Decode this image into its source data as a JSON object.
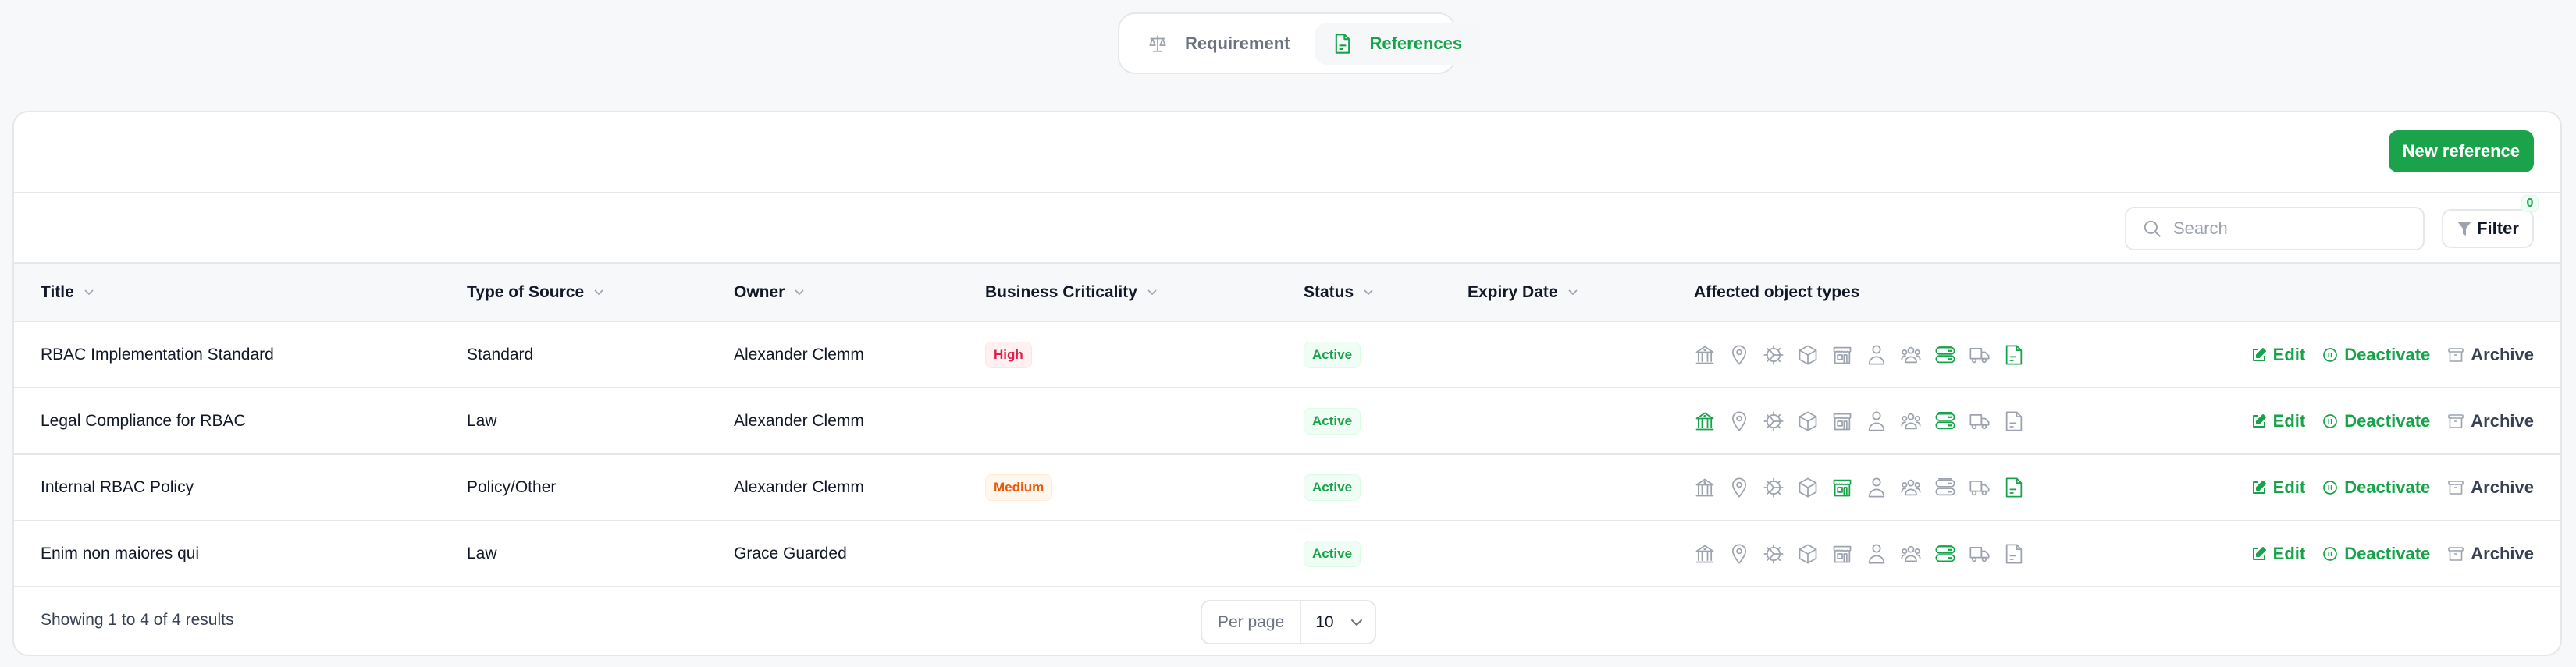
{
  "tabs": [
    {
      "label": "Requirement",
      "icon": "scale-icon",
      "active": false
    },
    {
      "label": "References",
      "icon": "document-icon",
      "active": true
    }
  ],
  "toolbar": {
    "new_button": "New reference",
    "search_placeholder": "Search",
    "search_value": "",
    "filter_label": "Filter",
    "filter_count": "0"
  },
  "colors": {
    "accent": "#16a34a",
    "icon_inactive": "#9ca3af",
    "high": "#e11d48",
    "medium": "#ea580c"
  },
  "table": {
    "columns": [
      "Title",
      "Type of Source",
      "Owner",
      "Business Criticality",
      "Status",
      "Expiry Date",
      "Affected object types"
    ],
    "object_types": [
      "bank-icon",
      "map-pin-icon",
      "gear-icon",
      "cube-icon",
      "store-icon",
      "user-icon",
      "users-icon",
      "server-icon",
      "truck-icon",
      "document-icon"
    ],
    "rows": [
      {
        "title": "RBAC Implementation Standard",
        "type": "Standard",
        "owner": "Alexander Clemm",
        "criticality": "High",
        "status": "Active",
        "expiry": "",
        "affected": [
          false,
          false,
          false,
          false,
          false,
          false,
          false,
          true,
          false,
          true
        ]
      },
      {
        "title": "Legal Compliance for RBAC",
        "type": "Law",
        "owner": "Alexander Clemm",
        "criticality": "",
        "status": "Active",
        "expiry": "",
        "affected": [
          true,
          false,
          false,
          false,
          false,
          false,
          false,
          true,
          false,
          false
        ]
      },
      {
        "title": "Internal RBAC Policy",
        "type": "Policy/Other",
        "owner": "Alexander Clemm",
        "criticality": "Medium",
        "status": "Active",
        "expiry": "",
        "affected": [
          false,
          false,
          false,
          false,
          true,
          false,
          false,
          false,
          false,
          true
        ]
      },
      {
        "title": "Enim non maiores qui",
        "type": "Law",
        "owner": "Grace Guarded",
        "criticality": "",
        "status": "Active",
        "expiry": "",
        "affected": [
          false,
          false,
          false,
          false,
          false,
          false,
          false,
          true,
          false,
          false
        ]
      }
    ],
    "actions": {
      "edit": "Edit",
      "deactivate": "Deactivate",
      "archive": "Archive"
    }
  },
  "footer": {
    "showing": "Showing 1 to 4 of 4 results",
    "per_page_label": "Per page",
    "per_page_value": "10"
  }
}
